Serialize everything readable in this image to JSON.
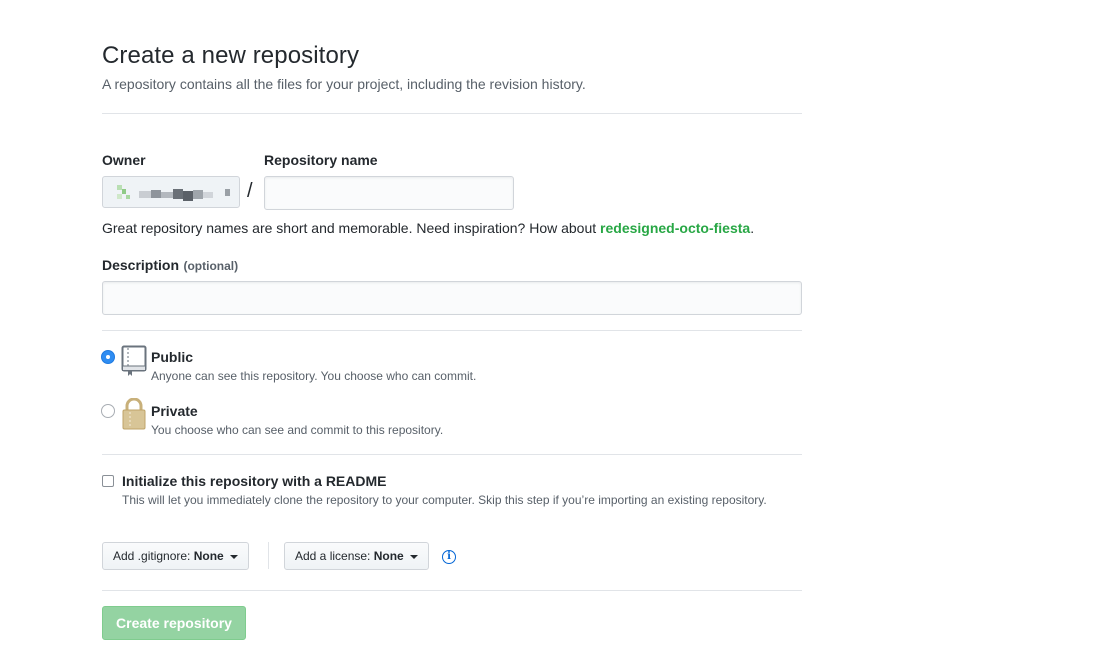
{
  "header": {
    "title": "Create a new repository",
    "subtitle": "A repository contains all the files for your project, including the revision history."
  },
  "owner": {
    "label": "Owner",
    "value": "",
    "icon": "avatar-icon"
  },
  "repo_name": {
    "label": "Repository name",
    "separator": "/",
    "value": "",
    "placeholder": ""
  },
  "hint": {
    "text": "Great repository names are short and memorable. Need inspiration? How about ",
    "suggestion": "redesigned-octo-fiesta",
    "end": "."
  },
  "description": {
    "label": "Description",
    "optional": "(optional)",
    "value": "",
    "placeholder": ""
  },
  "visibility": {
    "public": {
      "title": "Public",
      "desc": "Anyone can see this repository. You choose who can commit.",
      "icon": "repo-icon",
      "selected": true
    },
    "private": {
      "title": "Private",
      "desc": "You choose who can see and commit to this repository.",
      "icon": "lock-icon",
      "selected": false
    }
  },
  "readme": {
    "label": "Initialize this repository with a README",
    "desc": "This will let you immediately clone the repository to your computer. Skip this step if you’re importing an existing repository.",
    "checked": false
  },
  "gitignore": {
    "label": "Add .gitignore:",
    "value": "None"
  },
  "license": {
    "label": "Add a license:",
    "value": "None",
    "info_icon": "info-icon"
  },
  "submit": {
    "label": "Create repository",
    "disabled": true
  },
  "colors": {
    "accent_green": "#28a745",
    "disabled_green": "#94d3a2",
    "radio_blue": "#2f8df2",
    "info_blue": "#0366d6"
  }
}
